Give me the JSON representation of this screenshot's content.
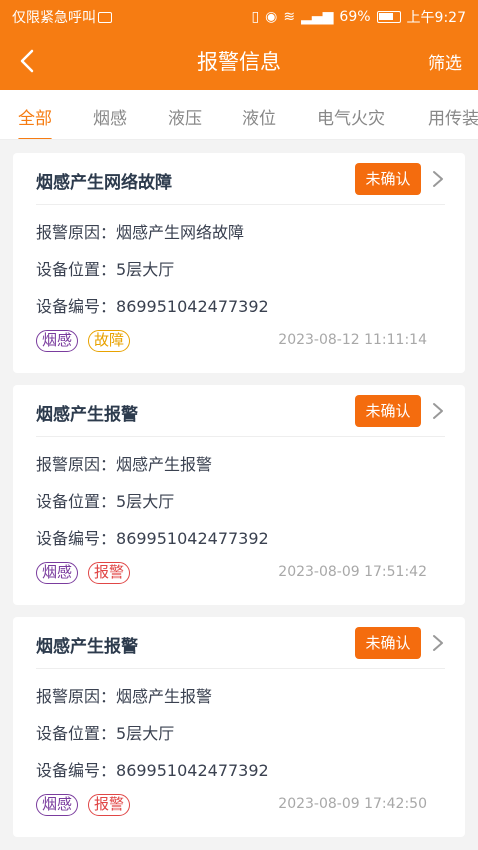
{
  "status": {
    "left_text": "仅限紧急呼叫",
    "battery": "69%",
    "time": "上午9:27"
  },
  "nav": {
    "title": "报警信息",
    "filter": "筛选"
  },
  "tabs": [
    "全部",
    "烟感",
    "液压",
    "液位",
    "电气火灾",
    "用传装"
  ],
  "labels": {
    "reason": "报警原因：",
    "location": "设备位置：",
    "code": "设备编号："
  },
  "cards": [
    {
      "title": "烟感产生网络故障",
      "button": "未确认",
      "reason": "烟感产生网络故障",
      "location": "5层大厅",
      "code": "869951042477392",
      "tags": [
        "烟感",
        "故障"
      ],
      "time": "2023-08-12 11:11:14"
    },
    {
      "title": "烟感产生报警",
      "button": "未确认",
      "reason": "烟感产生报警",
      "location": "5层大厅",
      "code": "869951042477392",
      "tags": [
        "烟感",
        "报警"
      ],
      "time": "2023-08-09 17:51:42"
    },
    {
      "title": "烟感产生报警",
      "button": "未确认",
      "reason": "烟感产生报警",
      "location": "5层大厅",
      "code": "869951042477392",
      "tags": [
        "烟感",
        "报警"
      ],
      "time": "2023-08-09 17:42:50"
    }
  ]
}
